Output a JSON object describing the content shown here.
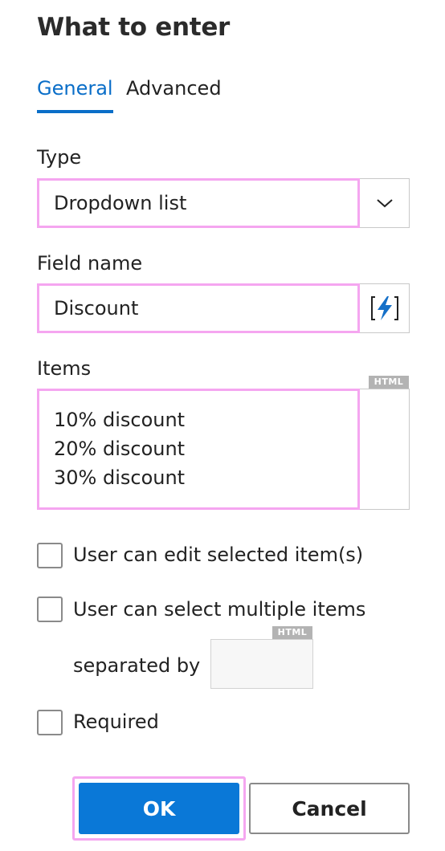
{
  "dialog": {
    "title": "What to enter"
  },
  "tabs": [
    {
      "label": "General",
      "active": true
    },
    {
      "label": "Advanced",
      "active": false
    }
  ],
  "type_field": {
    "label": "Type",
    "value": "Dropdown list"
  },
  "field_name": {
    "label": "Field name",
    "value": "Discount",
    "insert_icon_text": "[⚡]"
  },
  "items_field": {
    "label": "Items",
    "badge": "HTML",
    "values": [
      "10% discount",
      "20% discount",
      "30% discount"
    ]
  },
  "options": {
    "edit_selected": {
      "label": "User can edit selected item(s)",
      "checked": false
    },
    "select_multiple": {
      "label": "User can select multiple items",
      "checked": false
    },
    "separated_by": {
      "label": "separated by",
      "badge": "HTML",
      "value": ""
    },
    "required": {
      "label": "Required",
      "checked": false
    }
  },
  "buttons": {
    "ok": "OK",
    "cancel": "Cancel"
  },
  "colors": {
    "accent": "#0a6ec8",
    "ok_button": "#0a78d7",
    "highlight": "#f5a6f0"
  }
}
